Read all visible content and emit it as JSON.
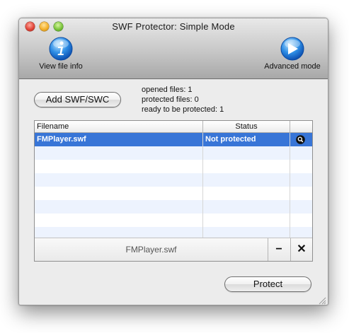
{
  "window": {
    "title": "SWF Protector:  Simple Mode"
  },
  "toolbar": {
    "info_label": "View file info",
    "advanced_label": "Advanced mode"
  },
  "actions": {
    "add_label": "Add SWF/SWC",
    "protect_label": "Protect"
  },
  "stats": {
    "opened": "opened files: 1",
    "protected": "protected files: 0",
    "ready": "ready to be protected: 1"
  },
  "table": {
    "headers": {
      "filename": "Filename",
      "status": "Status"
    },
    "rows": [
      {
        "filename": "FMPlayer.swf",
        "status": "Not protected",
        "action_icon": "magnifier-icon"
      }
    ]
  },
  "bottom": {
    "selected_filename": "FMPlayer.swf",
    "remove_symbol": "−",
    "clear_symbol": "✕"
  },
  "colors": {
    "selection": "#3875d7",
    "alt_row": "#edf3fe",
    "toolbar_icon_blue": "#2f8fe6"
  }
}
